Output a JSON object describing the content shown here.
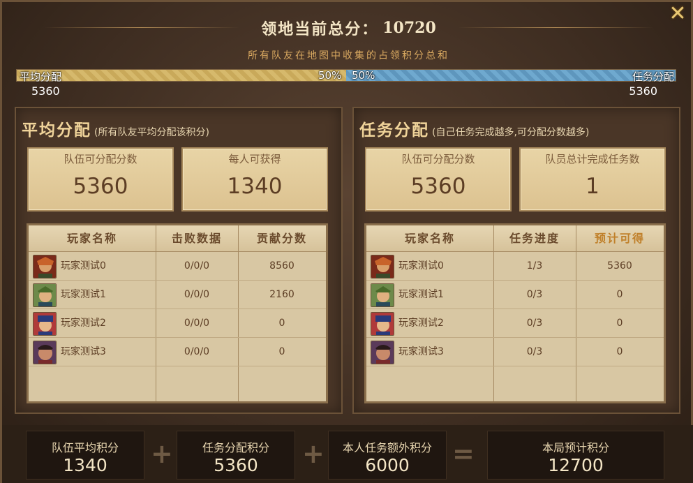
{
  "header": {
    "title_label": "领地当前总分：",
    "title_value": "10720",
    "subtitle": "所有队友在地图中收集的占领积分总和",
    "close_icon": "close-icon"
  },
  "split_bar": {
    "left_label": "平均分配",
    "left_percent": "50%",
    "left_value": "5360",
    "right_label": "任务分配",
    "right_percent": "50%",
    "right_value": "5360",
    "left_fraction": 0.5,
    "left_color": "#d6b96c",
    "right_color": "#6fa9cf"
  },
  "left_panel": {
    "title": "平均分配",
    "note": "(所有队友平均分配该积分)",
    "stat1_label": "队伍可分配分数",
    "stat1_value": "5360",
    "stat2_label": "每人可获得",
    "stat2_value": "1340",
    "columns": [
      "玩家名称",
      "击败数据",
      "贡献分数"
    ],
    "rows": [
      {
        "name": "玩家测试0",
        "col2": "0/0/0",
        "col3": "8560"
      },
      {
        "name": "玩家测试1",
        "col2": "0/0/0",
        "col3": "2160"
      },
      {
        "name": "玩家测试2",
        "col2": "0/0/0",
        "col3": "0"
      },
      {
        "name": "玩家测试3",
        "col2": "0/0/0",
        "col3": "0"
      }
    ]
  },
  "right_panel": {
    "title": "任务分配",
    "note": "(自己任务完成越多,可分配分数越多)",
    "stat1_label": "队伍可分配分数",
    "stat1_value": "5360",
    "stat2_label": "队员总计完成任务数",
    "stat2_value": "1",
    "columns": [
      "玩家名称",
      "任务进度",
      "预计可得"
    ],
    "rows": [
      {
        "name": "玩家测试0",
        "col2": "1/3",
        "col3": "5360"
      },
      {
        "name": "玩家测试1",
        "col2": "0/3",
        "col3": "0"
      },
      {
        "name": "玩家测试2",
        "col2": "0/3",
        "col3": "0"
      },
      {
        "name": "玩家测试3",
        "col2": "0/3",
        "col3": "0"
      }
    ]
  },
  "footer": {
    "team_avg_label": "队伍平均积分",
    "team_avg_value": "1340",
    "task_alloc_label": "任务分配积分",
    "task_alloc_value": "5360",
    "extra_label": "本人任务额外积分",
    "extra_value": "6000",
    "total_label": "本局预计积分",
    "total_value": "12700",
    "plus": "+",
    "equals": "="
  }
}
